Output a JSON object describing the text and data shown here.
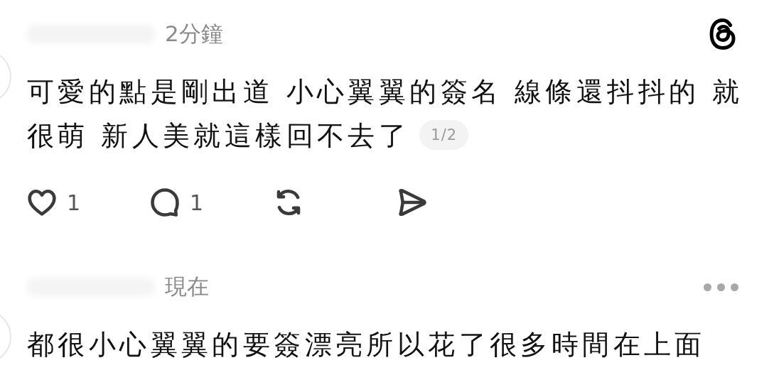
{
  "posts": [
    {
      "time": "2分鐘",
      "corner": {
        "kind": "logo"
      },
      "body": "可愛的點是剛出道 小心翼翼的簽名 線條還抖抖的 就很萌 新人美就這樣回不去了",
      "page_badge": "1/2",
      "actions": [
        {
          "kind": "like",
          "count": "1"
        },
        {
          "kind": "reply",
          "count": "1"
        },
        {
          "kind": "repost"
        },
        {
          "kind": "share"
        }
      ]
    },
    {
      "time": "現在",
      "corner": {
        "kind": "more"
      },
      "body": "都很小心翼翼的要簽漂亮所以花了很多時間在上面"
    }
  ]
}
